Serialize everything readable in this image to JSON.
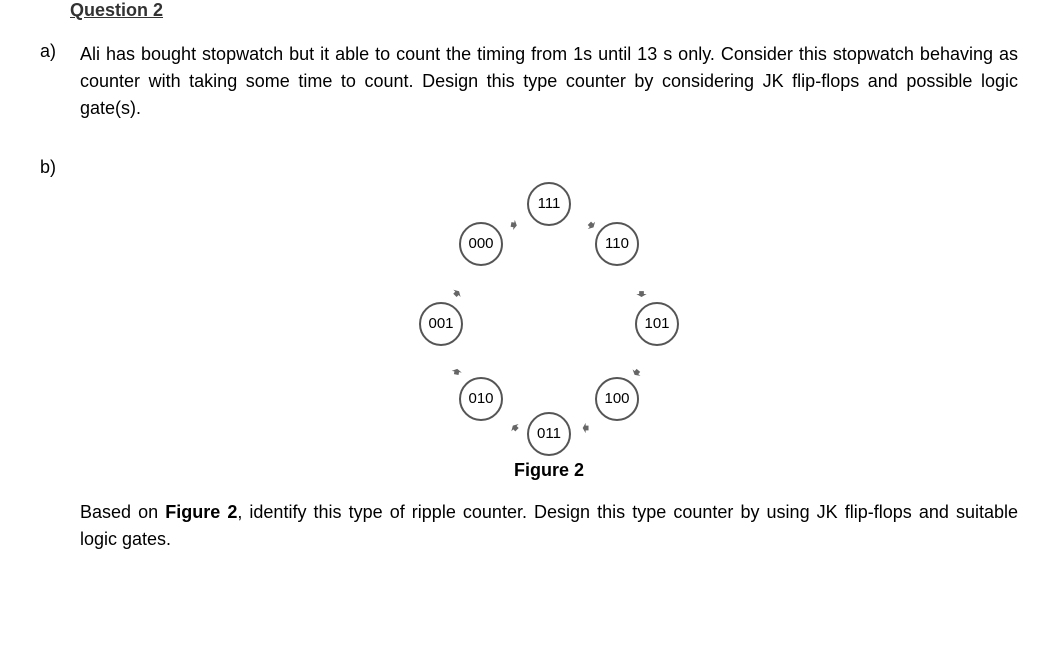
{
  "heading": "Question 2",
  "partA": {
    "label": "a)",
    "text": "Ali has bought stopwatch but it able to count the timing from 1s until 13 s only. Consider this stopwatch behaving as counter with taking some time to count. Design this type counter by considering JK flip-flops and possible logic gate(s)."
  },
  "partB": {
    "label": "b)",
    "states": {
      "s111": "111",
      "s000": "000",
      "s110": "110",
      "s001": "001",
      "s101": "101",
      "s010": "010",
      "s100": "100",
      "s011": "011"
    },
    "figureLabel": "Figure 2",
    "textPrefix": "Based on ",
    "textBold": "Figure 2",
    "textSuffix": ", identify this type of ripple counter. Design this type counter by using JK flip-flops and suitable logic gates."
  }
}
